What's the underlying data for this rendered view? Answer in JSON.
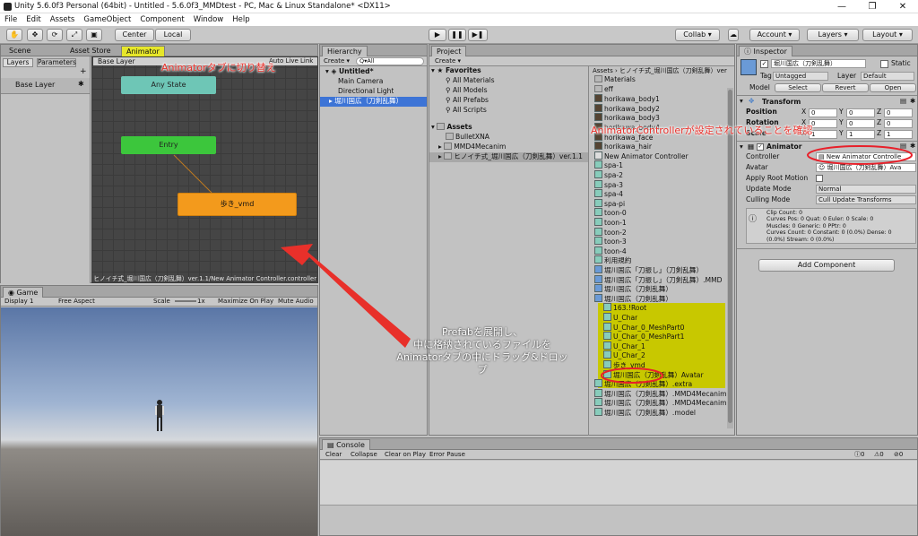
{
  "window": {
    "title": "Unity 5.6.0f3 Personal (64bit) - Untitled - 5.6.0f3_MMDtest - PC, Mac & Linux Standalone* <DX11>",
    "minimize": "—",
    "maximize": "❐",
    "close": "✕"
  },
  "menu": [
    "File",
    "Edit",
    "Assets",
    "GameObject",
    "Component",
    "Window",
    "Help"
  ],
  "toolbar": {
    "center": "Center",
    "local": "Local",
    "collab": "Collab ▾",
    "account": "Account ▾",
    "layers": "Layers ▾",
    "layout": "Layout ▾",
    "play": "▶",
    "pause": "❚❚",
    "step": "▶❚"
  },
  "animator": {
    "tabs": {
      "scene": "Scene",
      "asset_store": "Asset Store",
      "animator": "Animator"
    },
    "sub_tabs": {
      "layers": "Layers",
      "parameters": "Parameters"
    },
    "breadcrumb": "Base Layer",
    "auto_live": "Auto Live Link",
    "base_layer": "Base Layer",
    "add": "+",
    "states": {
      "any": "Any State",
      "entry": "Entry",
      "walk": "歩き_vmd"
    },
    "footer": "ヒノイチ式_堀川国広（刀剣乱舞）ver.1.1/New Animator Controller.controller"
  },
  "game": {
    "tab": "Game",
    "display": "Display 1",
    "aspect": "Free Aspect",
    "scale": "Scale",
    "scale_val": "1x",
    "maximize": "Maximize On Play",
    "mute": "Mute Audio"
  },
  "hierarchy": {
    "tab": "Hierarchy",
    "create": "Create ▾",
    "search": "Q▾All",
    "scene": "Untitled*",
    "items": [
      "Main Camera",
      "Directional Light",
      "堀川国広（刀剣乱舞）"
    ]
  },
  "project": {
    "tab": "Project",
    "create": "Create ▾",
    "favorites": "Favorites",
    "fav_items": [
      "All Materials",
      "All Models",
      "All Prefabs",
      "All Scripts"
    ],
    "assets": "Assets",
    "asset_items": [
      "BulletXNA",
      "MMD4Mecanim",
      "ヒノイチ式_堀川国広（刀剣乱舞）ver.1.1"
    ],
    "path": "Assets › ヒノイチ式_堀川国広（刀剣乱舞）ver.1.1 ›",
    "files": [
      "Materials",
      "eff",
      "horikawa_body1",
      "horikawa_body2",
      "horikawa_body3",
      "horikawa_body4",
      "horikawa_face",
      "horikawa_hair",
      "New Animator Controller",
      "spa-1",
      "spa-2",
      "spa-3",
      "spa-4",
      "spa-pi",
      "toon-0",
      "toon-1",
      "toon-2",
      "toon-3",
      "toon-4",
      "利用規約",
      "堀川国広「刀振し」（刀剣乱舞）",
      "堀川国広「刀振し」（刀剣乱舞）.MMD",
      "堀川国広（刀剣乱舞）",
      "堀川国広（刀剣乱舞）"
    ],
    "prefab_children": [
      "163.!Root",
      "U_Char",
      "U_Char_0_MeshPart0",
      "U_Char_0_MeshPart1",
      "U_Char_1",
      "U_Char_2",
      "歩き_vmd",
      "堀川国広（刀剣乱舞）Avatar"
    ],
    "files_after": [
      "堀川国広（刀剣乱舞）.extra",
      "堀川国広（刀剣乱舞）.MMD4Mecanim",
      "堀川国広（刀剣乱舞）.MMD4Mecanim",
      "堀川国広（刀剣乱舞）.model"
    ]
  },
  "inspector": {
    "tab": "Inspector",
    "name": "堀川国広（刀剣乱舞）",
    "static": "Static",
    "tag_label": "Tag",
    "tag": "Untagged",
    "layer_label": "Layer",
    "layer": "Default",
    "model_label": "Model",
    "select": "Select",
    "revert": "Revert",
    "open": "Open",
    "transform": "Transform",
    "position": "Position",
    "rotation": "Rotation",
    "scale": "Scale",
    "pos": [
      "0",
      "0",
      "0"
    ],
    "rot": [
      "0",
      "0",
      "0"
    ],
    "scl": [
      "1",
      "1",
      "1"
    ],
    "axes": [
      "X",
      "Y",
      "Z"
    ],
    "animator": "Animator",
    "controller_label": "Controller",
    "controller": "New Animator Controlle",
    "avatar_label": "Avatar",
    "avatar": "堀川国広（刀剣乱舞）Ava",
    "root_motion": "Apply Root Motion",
    "update_label": "Update Mode",
    "update": "Normal",
    "culling_label": "Culling Mode",
    "culling": "Cull Update Transforms",
    "stats": [
      "Clip Count: 0",
      "Curves Pos: 0 Quat: 0 Euler: 0 Scale: 0",
      "Muscles: 0 Generic: 0 PPtr: 0",
      "Curves Count: 0 Constant: 0 (0.0%) Dense: 0",
      "(0.0%) Stream: 0 (0.0%)"
    ],
    "add_component": "Add Component"
  },
  "console": {
    "tab": "Console",
    "clear": "Clear",
    "collapse": "Collapse",
    "clear_on_play": "Clear on Play",
    "error_pause": "Error Pause"
  },
  "annotations": {
    "animator_tab": "Animatorタブに切り替え",
    "controller_check": "AnimatorControllerが設定されていることを確認",
    "prefab_line1": "Prefabを展開し、",
    "prefab_line2": "中に格納されているファイルを",
    "prefab_line3": "Animatorタブの中にドラッグ&ドロップ"
  },
  "colors": {
    "any_state": "#6ec6b6",
    "entry": "#3cc63c",
    "walk_state": "#f39a1c",
    "highlight": "#c8c800",
    "arrow": "#e8302a"
  }
}
